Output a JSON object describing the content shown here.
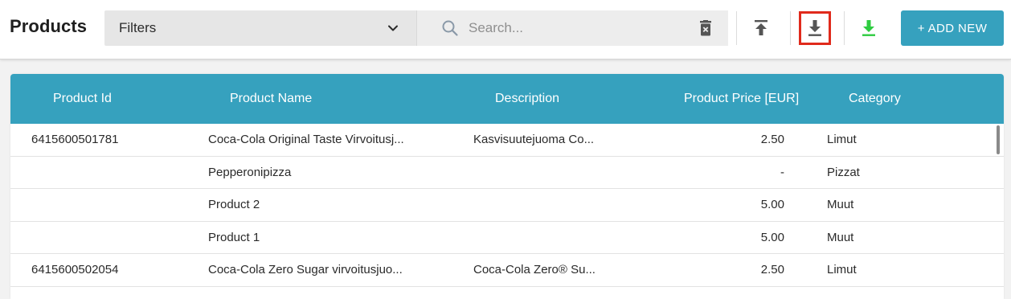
{
  "header": {
    "title": "Products",
    "filters_label": "Filters",
    "search_placeholder": "Search...",
    "add_new_label": "+ ADD NEW"
  },
  "icons": {
    "chevron": "chevron-down-icon",
    "search": "search-icon",
    "clear": "trash-clear-icon",
    "upload": "upload-icon",
    "download": "download-icon",
    "download_green": "download-green-icon"
  },
  "colors": {
    "accent": "#36a1be",
    "highlight": "#e02a1c",
    "download_green": "#2ecc40"
  },
  "table": {
    "columns": [
      "Product Id",
      "Product Name",
      "Description",
      "Product Price [EUR]",
      "Category"
    ],
    "rows": [
      {
        "id": "6415600501781",
        "name": "Coca-Cola Original Taste Virvoitusj...",
        "description": "Kasvisuutejuoma Co...",
        "price": "2.50",
        "category": "Limut"
      },
      {
        "id": "",
        "name": "Pepperonipizza",
        "description": "",
        "price": "-",
        "category": "Pizzat"
      },
      {
        "id": "",
        "name": "Product 2",
        "description": "",
        "price": "5.00",
        "category": "Muut"
      },
      {
        "id": "",
        "name": "Product 1",
        "description": "",
        "price": "5.00",
        "category": "Muut"
      },
      {
        "id": "6415600502054",
        "name": "Coca-Cola Zero Sugar virvoitusjuo...",
        "description": "Coca-Cola Zero® Su...",
        "price": "2.50",
        "category": "Limut"
      }
    ]
  }
}
